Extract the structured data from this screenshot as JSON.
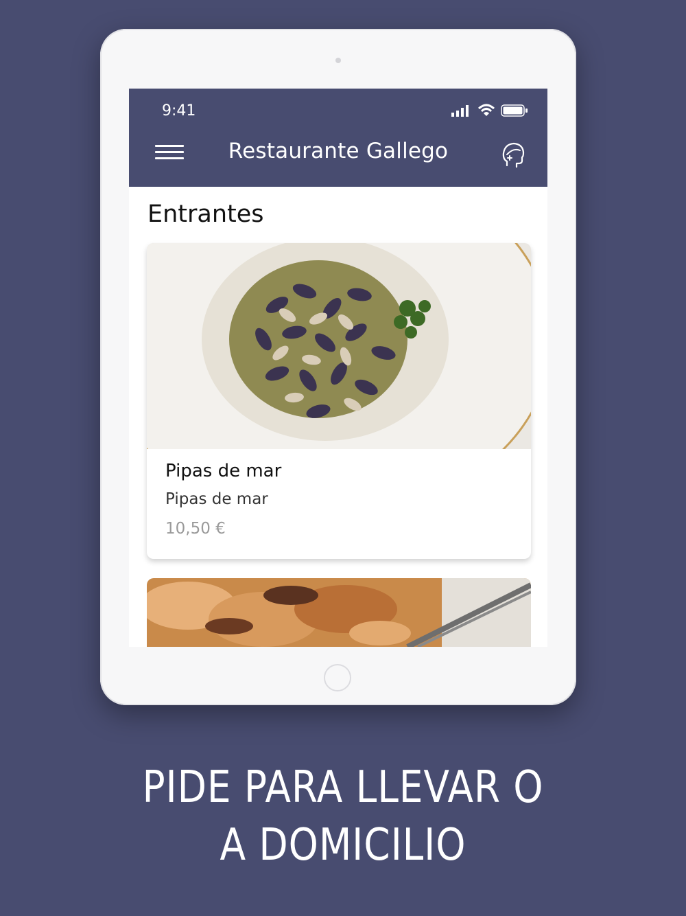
{
  "status_bar": {
    "time": "9:41"
  },
  "navbar": {
    "title": "Restaurante Gallego"
  },
  "section": {
    "title": "Entrantes"
  },
  "items": [
    {
      "name": "Pipas de mar",
      "description": "Pipas de mar",
      "price": "10,50 €"
    }
  ],
  "promo": {
    "line1": "PIDE PARA LLEVAR O",
    "line2": "A DOMICILIO"
  },
  "colors": {
    "brand": "#484c70",
    "background": "#484c70",
    "price": "#9a9a9a"
  },
  "icons": [
    "menu-icon",
    "waiter-icon",
    "signal-icon",
    "wifi-icon",
    "battery-icon"
  ]
}
